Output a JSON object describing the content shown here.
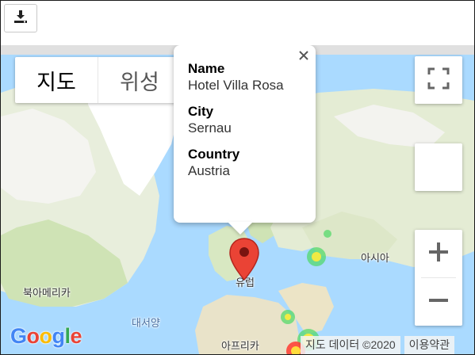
{
  "toolbar": {
    "download_icon": "download-icon"
  },
  "map": {
    "type_control": {
      "map_label": "지도",
      "satellite_label": "위성"
    },
    "labels": {
      "north_america": "북아메리카",
      "atlantic": "대서양",
      "europe": "유럽",
      "asia": "아시아",
      "africa": "아프리카"
    },
    "info_window": {
      "name_label": "Name",
      "name_value": "Hotel Villa Rosa",
      "city_label": "City",
      "city_value": "Sernau",
      "country_label": "Country",
      "country_value": "Austria"
    },
    "controls": {
      "fullscreen_icon": "fullscreen-icon",
      "zoom_in_icon": "plus-icon",
      "zoom_out_icon": "minus-icon"
    },
    "logo_text": "Google",
    "attribution": {
      "data_text": "지도 데이터 ©2020",
      "terms_text": "이용약관"
    },
    "colors": {
      "water": "#aadaff",
      "land": "#e8f0d8",
      "marker": "#ea4335",
      "heat_green": "#4cd964",
      "heat_yellow": "#ffeb3b",
      "heat_red": "#ff3b30"
    }
  }
}
